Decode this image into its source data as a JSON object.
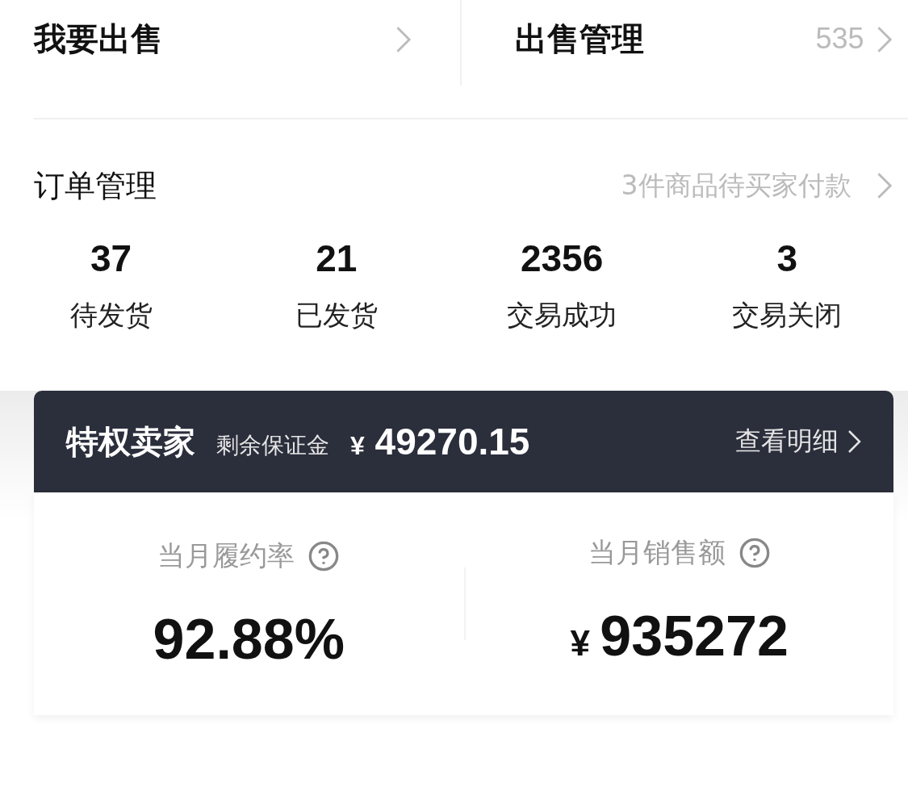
{
  "sell": {
    "title": "我要出售"
  },
  "sales_management": {
    "title": "出售管理",
    "count": "535"
  },
  "orders": {
    "title": "订单管理",
    "hint": "3件商品待买家付款",
    "stats": [
      {
        "value": "37",
        "label": "待发货"
      },
      {
        "value": "21",
        "label": "已发货"
      },
      {
        "value": "2356",
        "label": "交易成功"
      },
      {
        "value": "3",
        "label": "交易关闭"
      }
    ]
  },
  "seller_card": {
    "title": "特权卖家",
    "deposit_label": "剩余保证金",
    "currency": "¥",
    "deposit": "49270.15",
    "details_link": "查看明细"
  },
  "metrics": [
    {
      "label": "当月履约率",
      "value": "92.88%"
    },
    {
      "label": "当月销售额",
      "currency": "¥",
      "value": "935272"
    }
  ]
}
